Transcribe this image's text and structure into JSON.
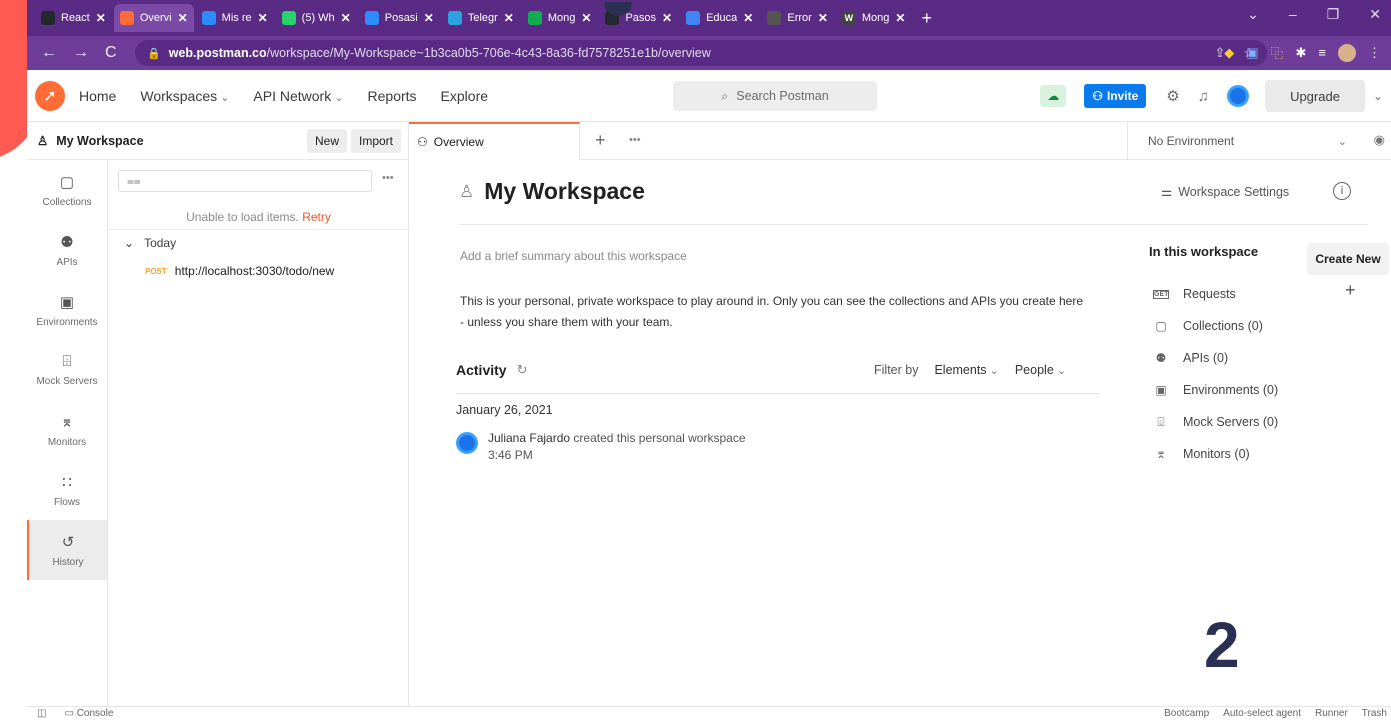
{
  "browser": {
    "tabs": [
      {
        "label": "React",
        "fav": "",
        "color": "#24292e"
      },
      {
        "label": "Overvi",
        "fav": "",
        "color": "#ff6c37",
        "active": true
      },
      {
        "label": "Mis re",
        "fav": "",
        "color": "#2d8cff"
      },
      {
        "label": "(5) Wh",
        "fav": "",
        "color": "#25d366"
      },
      {
        "label": "Posasi",
        "fav": "",
        "color": "#2d8cff"
      },
      {
        "label": "Telegr",
        "fav": "",
        "color": "#2aa3df"
      },
      {
        "label": "Mong",
        "fav": "",
        "color": "#13aa52"
      },
      {
        "label": "Pasos",
        "fav": "",
        "color": "#24292e"
      },
      {
        "label": "Educa",
        "fav": "",
        "color": "#4285f4"
      },
      {
        "label": "Error",
        "fav": "",
        "color": "#555"
      },
      {
        "label": "Mong",
        "fav": "W",
        "color": "#444"
      }
    ],
    "url_host": "web.postman.co",
    "url_path": "/workspace/My-Workspace~1b3ca0b5-706e-4c43-8a36-fd7578251e1b/overview"
  },
  "header": {
    "nav": {
      "home": "Home",
      "workspaces": "Workspaces",
      "api_network": "API Network",
      "reports": "Reports",
      "explore": "Explore"
    },
    "search_placeholder": "Search Postman",
    "invite": "Invite",
    "upgrade": "Upgrade"
  },
  "sidebar": {
    "workspace_name": "My Workspace",
    "new": "New",
    "import": "Import",
    "rail": [
      {
        "label": "Collections",
        "icon": "▢"
      },
      {
        "label": "APIs",
        "icon": "⚉"
      },
      {
        "label": "Environments",
        "icon": "▣"
      },
      {
        "label": "Mock Servers",
        "icon": "⌹"
      },
      {
        "label": "Monitors",
        "icon": "⌆"
      },
      {
        "label": "Flows",
        "icon": "∷"
      },
      {
        "label": "History",
        "icon": "↺"
      }
    ],
    "error_text": "Unable to load items.",
    "retry": "Retry",
    "group": "Today",
    "request_method": "POST",
    "request_url": "http://localhost:3030/todo/new"
  },
  "tabs": {
    "overview": "Overview",
    "environment": "No Environment"
  },
  "overview": {
    "title": "My Workspace",
    "settings": "Workspace Settings",
    "summary_placeholder": "Add a brief summary about this workspace",
    "description": "This is your personal, private workspace to play around in. Only you can see the collections and APIs you create here - unless you share them with your team.",
    "activity_title": "Activity",
    "filter_by": "Filter by",
    "filter_elements": "Elements",
    "filter_people": "People",
    "date": "January 26, 2021",
    "activity_user": "Juliana Fajardo",
    "activity_action": "created this personal workspace",
    "activity_time": "3:46 PM",
    "in_workspace": "In this workspace",
    "create_new": "Create New",
    "items": [
      {
        "label": "Requests",
        "icon": "GET"
      },
      {
        "label": "Collections (0)",
        "icon": "▢"
      },
      {
        "label": "APIs (0)",
        "icon": "⚉"
      },
      {
        "label": "Environments (0)",
        "icon": "▣"
      },
      {
        "label": "Mock Servers (0)",
        "icon": "⌹"
      },
      {
        "label": "Monitors (0)",
        "icon": "⌆"
      }
    ]
  },
  "slide_number": "2",
  "status": {
    "console": "Console",
    "right": [
      "Bootcamp",
      "Auto-select agent",
      "Runner",
      "Trash"
    ]
  }
}
